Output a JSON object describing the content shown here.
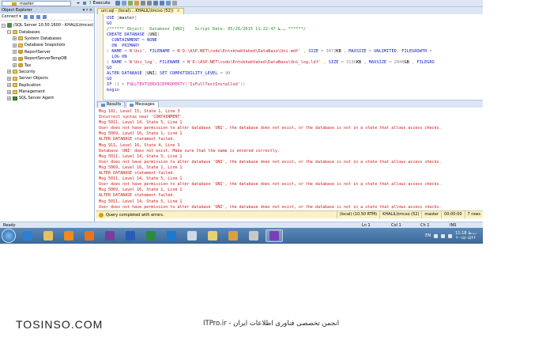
{
  "toolbar": {
    "database_combo": "master",
    "execute_label": "Execute"
  },
  "object_explorer": {
    "title": "Object Explorer",
    "pin_label": "▾ ♯ ×",
    "connect_label": "Connect ▾",
    "items": [
      {
        "label": "(SQL Server 10.50.1600 - KHALIL\\tmcso)",
        "level": 0,
        "expander": "−",
        "icon": "server-icon"
      },
      {
        "label": "Databases",
        "level": 1,
        "expander": "−",
        "icon": "folder-icon"
      },
      {
        "label": "System Databases",
        "level": 2,
        "expander": "+",
        "icon": "folder-icon"
      },
      {
        "label": "Database Snapshots",
        "level": 2,
        "expander": "+",
        "icon": "folder-icon"
      },
      {
        "label": "ReportServer",
        "level": 2,
        "expander": "+",
        "icon": "database-icon"
      },
      {
        "label": "ReportServerTempDB",
        "level": 2,
        "expander": "+",
        "icon": "database-icon"
      },
      {
        "label": "Tax",
        "level": 2,
        "expander": "+",
        "icon": "database-icon"
      },
      {
        "label": "Security",
        "level": 1,
        "expander": "+",
        "icon": "folder-icon"
      },
      {
        "label": "Server Objects",
        "level": 1,
        "expander": "+",
        "icon": "folder-icon"
      },
      {
        "label": "Replication",
        "level": 1,
        "expander": "+",
        "icon": "folder-icon"
      },
      {
        "label": "Management",
        "level": 1,
        "expander": "+",
        "icon": "folder-icon"
      },
      {
        "label": "SQL Server Agent",
        "level": 1,
        "expander": "+",
        "icon": "agent-icon"
      }
    ]
  },
  "editor": {
    "tab_label": "uni.sql - (local)....KHALIL\\tmcso (52))",
    "tab_close": "×",
    "lines": [
      "USE [master]",
      "GO",
      "/****** Object:  Database [UNI]    Script Date: 05/26/2015 11:22:47 ب.ظ ******/",
      "CREATE DATABASE [UNI]",
      "  CONTAINMENT = NONE",
      "  ON  PRIMARY",
      "( NAME = N'Uni', FILENAME = N'D:\\ASP.NET\\code\\EntekhabVahed\\DataBase\\Uni.mdf' , SIZE = 3072KB , MAXSIZE = UNLIMITED, FILEGROWTH =",
      "  LOG ON",
      "( NAME = N'Uni_log', FILENAME = N'D:\\ASP.NET\\code\\EntekhabVahed\\DataBase\\Uni_log.ldf' , SIZE = 3136KB , MAXSIZE = 2048GB , FILEGRO",
      "GO",
      "ALTER DATABASE [UNI] SET COMPATIBILITY_LEVEL = 90",
      "GO",
      "IF (1 = FULLTEXTSERVICEPROPERTY('IsFullTextInstalled'))",
      "begin"
    ]
  },
  "results": {
    "tabs": [
      {
        "label": "Results",
        "active": false
      },
      {
        "label": "Messages",
        "active": true
      }
    ],
    "messages": [
      "Msg 102, Level 15, State 1, Line 3",
      "Incorrect syntax near 'CONTAINMENT'.",
      "Msg 5011, Level 14, State 5, Line 1",
      "User does not have permission to alter database 'UNI', the database does not exist, or the database is not in a state that allows access checks.",
      "Msg 5069, Level 16, State 1, Line 1",
      "ALTER DATABASE statement failed.",
      "Msg 911, Level 16, State 4, Line 3",
      "Database 'UNI' does not exist. Make sure that the name is entered correctly.",
      "Msg 5011, Level 14, State 5, Line 1",
      "User does not have permission to alter database 'UNI', the database does not exist, or the database is not in a state that allows access checks.",
      "Msg 5069, Level 16, State 1, Line 1",
      "ALTER DATABASE statement failed.",
      "Msg 5011, Level 14, State 5, Line 1",
      "User does not have permission to alter database 'UNI', the database does not exist, or the database is not in a state that allows access checks.",
      "Msg 5069, Level 16, State 1, Line 1",
      "ALTER DATABASE statement failed.",
      "Msg 5011, Level 14, State 5, Line 1",
      "User does not have permission to alter database 'UNI', the database does not exist, or the database is not in a state that allows access checks."
    ]
  },
  "query_status": {
    "message": "Query completed with errors.",
    "server": "(local) (10.50 RTM)",
    "user": "KHALIL\\tmcso (52)",
    "database": "master",
    "time": "00:00:00",
    "rows": "7 rows"
  },
  "status_bar": {
    "ready": "Ready",
    "line": "Ln 1",
    "col": "Col 1",
    "ch": "Ch 1",
    "mode": "INS"
  },
  "taskbar": {
    "apps": [
      {
        "icon": "ie-icon",
        "color": "#2a7fd4"
      },
      {
        "icon": "folder-explorer-icon",
        "color": "#e8c15a"
      },
      {
        "icon": "media-player-icon",
        "color": "#f08a1c"
      },
      {
        "icon": "firefox-icon",
        "color": "#e8731c"
      },
      {
        "icon": "winrar-icon",
        "color": "#7a3f9a"
      },
      {
        "icon": "word-icon",
        "color": "#2a5bb8"
      },
      {
        "icon": "excel-icon",
        "color": "#2e8a3e"
      },
      {
        "icon": "teamviewer-icon",
        "color": "#1a7ad0"
      },
      {
        "icon": "window-icon",
        "color": "#cfd8e4"
      },
      {
        "icon": "folder-icon",
        "color": "#e8d070"
      },
      {
        "icon": "paint-icon",
        "color": "#d8a040"
      },
      {
        "icon": "sql-management-studio-icon",
        "color": "#c8c8c8"
      },
      {
        "icon": "visual-studio-icon",
        "color": "#7a3fb8"
      }
    ],
    "language": "EN",
    "time": "11:18 ب.ظ",
    "date": "۲۰۱۵/۰۵/۲۶"
  },
  "footer": {
    "left_text": "TOSINSO.COM",
    "right_text": "ITPro.ir - انجمن تخصصی فناوری اطلاعات ایران"
  }
}
